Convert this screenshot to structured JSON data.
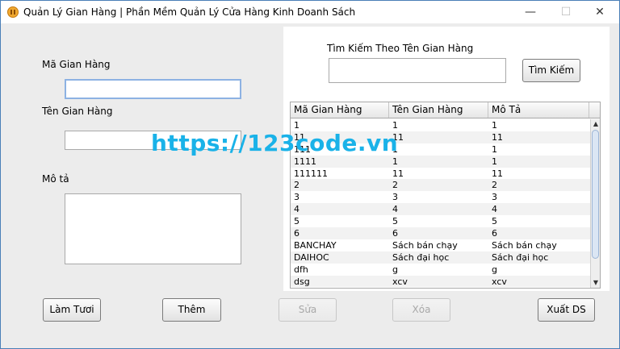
{
  "window": {
    "title": "Quản Lý Gian Hàng | Phần Mềm Quản Lý Cửa Hàng Kinh Doanh Sách",
    "controls": {
      "minimize": "—",
      "maximize": "☐",
      "close": "✕"
    }
  },
  "form": {
    "ma_label": "Mã Gian Hàng",
    "ma_value": "",
    "ten_label": "Tên Gian Hàng",
    "ten_value": "",
    "mota_label": "Mô tả",
    "mota_value": ""
  },
  "search": {
    "label": "Tìm Kiếm Theo Tên Gian Hàng",
    "value": "",
    "button": "Tìm Kiếm"
  },
  "table": {
    "columns": [
      "Mã Gian Hàng",
      "Tên Gian Hàng",
      "Mô Tả"
    ],
    "rows": [
      [
        "1",
        "1",
        "1"
      ],
      [
        "11",
        "11",
        "11"
      ],
      [
        "111",
        "1",
        "1"
      ],
      [
        "1111",
        "1",
        "1"
      ],
      [
        "111111",
        "11",
        "11"
      ],
      [
        "2",
        "2",
        "2"
      ],
      [
        "3",
        "3",
        "3"
      ],
      [
        "4",
        "4",
        "4"
      ],
      [
        "5",
        "5",
        "5"
      ],
      [
        "6",
        "6",
        "6"
      ],
      [
        "BANCHAY",
        "Sách bán chạy",
        "Sách bán chạy"
      ],
      [
        "DAIHOC",
        "Sách đại học",
        "Sách đại học"
      ],
      [
        "dfh",
        "g",
        "g"
      ],
      [
        "dsg",
        "xcv",
        "xcv"
      ]
    ]
  },
  "buttons": {
    "refresh": "Làm Tươi",
    "add": "Thêm",
    "edit": "Sửa",
    "delete": "Xóa",
    "export": "Xuất DS"
  },
  "watermark": "https://123code.vn",
  "colors": {
    "watermark": "#1ab2e8",
    "focus_border": "#8db2e3"
  }
}
